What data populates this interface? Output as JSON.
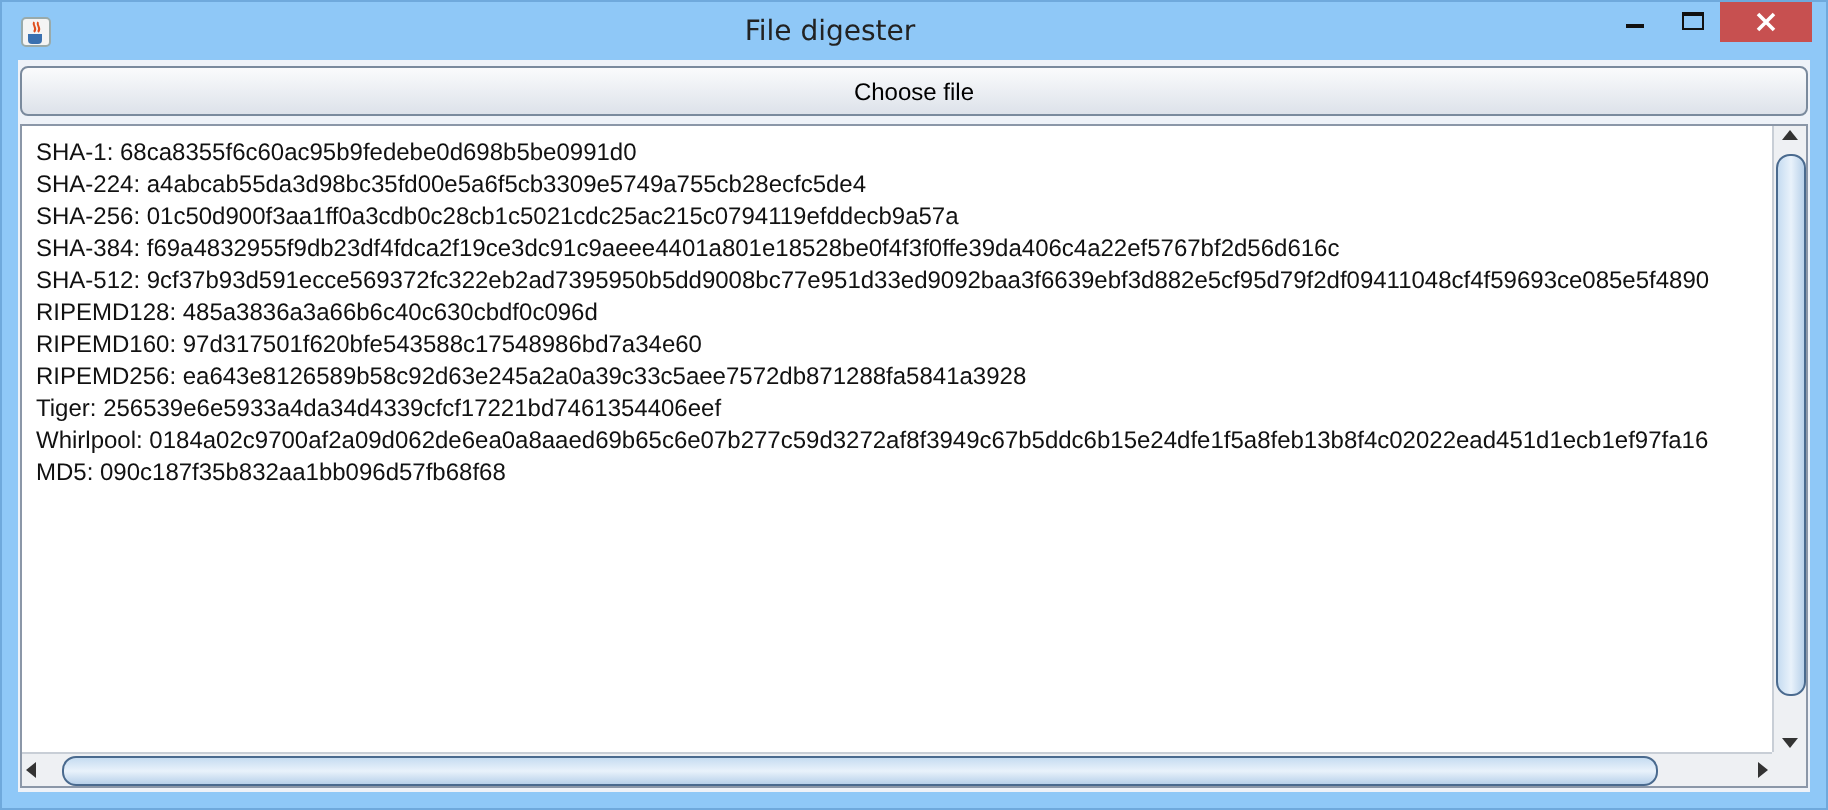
{
  "window": {
    "title": "File digester"
  },
  "button": {
    "label": "Choose file"
  },
  "digests": [
    {
      "text": "SHA-1: 68ca8355f6c60ac95b9fedebe0d698b5be0991d0"
    },
    {
      "text": "SHA-224: a4abcab55da3d98bc35fd00e5a6f5cb3309e5749a755cb28ecfc5de4"
    },
    {
      "text": "SHA-256: 01c50d900f3aa1ff0a3cdb0c28cb1c5021cdc25ac215c0794119efddecb9a57a"
    },
    {
      "text": "SHA-384: f69a4832955f9db23df4fdca2f19ce3dc91c9aeee4401a801e18528be0f4f3f0ffe39da406c4a22ef5767bf2d56d616c"
    },
    {
      "text": "SHA-512: 9cf37b93d591ecce569372fc322eb2ad7395950b5dd9008bc77e951d33ed9092baa3f6639ebf3d882e5cf95d79f2df09411048cf4f59693ce085e5f4890"
    },
    {
      "text": "RIPEMD128: 485a3836a3a66b6c40c630cbdf0c096d"
    },
    {
      "text": "RIPEMD160: 97d317501f620bfe543588c17548986bd7a34e60"
    },
    {
      "text": "RIPEMD256: ea643e8126589b58c92d63e245a2a0a39c33c5aee7572db871288fa5841a3928"
    },
    {
      "text": "Tiger: 256539e6e5933a4da34d4339cfcf17221bd7461354406eef"
    },
    {
      "text": "Whirlpool: 0184a02c9700af2a09d062de6ea0a8aaed69b65c6e07b277c59d3272af8f3949c67b5ddc6b15e24dfe1f5a8feb13b8f4c02022ead451d1ecb1ef97fa16"
    },
    {
      "text": "MD5: 090c187f35b832aa1bb096d57fb68f68"
    }
  ]
}
